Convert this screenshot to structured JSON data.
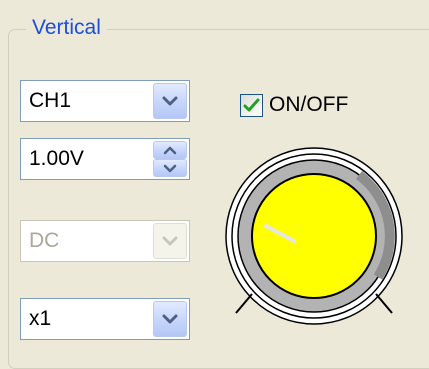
{
  "vertical": {
    "title": "Vertical",
    "channel": {
      "value": "CH1",
      "enabled": true
    },
    "volts_div": {
      "value": "1.00V",
      "enabled": true
    },
    "coupling": {
      "value": "DC",
      "enabled": false
    },
    "probe": {
      "value": "x1",
      "enabled": true
    },
    "onoff": {
      "label": "ON/OFF",
      "checked": true
    },
    "knob": {
      "icon": "rotary-knob"
    }
  },
  "colors": {
    "accent_blue": "#1c4ed8",
    "knob_fill": "#ffff00",
    "checkmark": "#21a121",
    "arrow": "#4d6185"
  }
}
